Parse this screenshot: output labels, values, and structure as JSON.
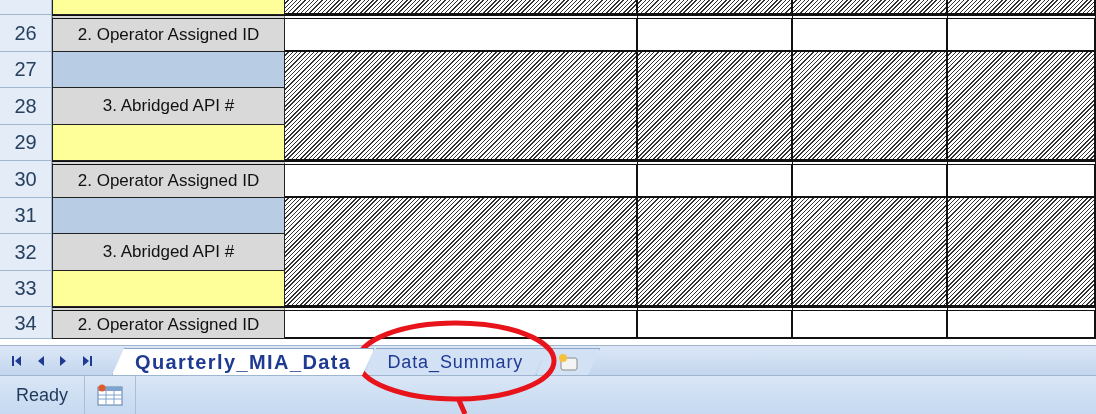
{
  "rows": [
    {
      "kind": "entry"
    },
    {
      "number": "26",
      "kind": "id",
      "label": "2. Operator Assigned ID"
    },
    {
      "number": "27",
      "kind": "blank"
    },
    {
      "number": "28",
      "kind": "label",
      "label": "3. Abridged API #"
    },
    {
      "number": "29",
      "kind": "entry"
    },
    {
      "number": "30",
      "kind": "id",
      "label": "2. Operator Assigned ID"
    },
    {
      "number": "31",
      "kind": "blank"
    },
    {
      "number": "32",
      "kind": "label",
      "label": "3. Abridged API #"
    },
    {
      "number": "33",
      "kind": "entry"
    },
    {
      "number": "34",
      "kind": "id",
      "label": "2. Operator Assigned ID"
    }
  ],
  "sheet_tabs": [
    {
      "label": "Quarterly_MIA_Data",
      "selected": true
    },
    {
      "label": "Data_Summary",
      "selected": false
    }
  ],
  "status_bar": {
    "text": "Ready"
  }
}
